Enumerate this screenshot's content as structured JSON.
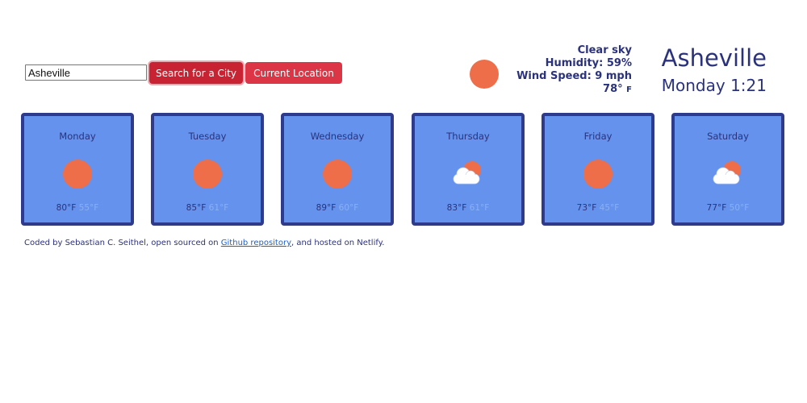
{
  "search": {
    "value": "Asheville",
    "search_button_label": "Search for a City",
    "location_button_label": "Current Location"
  },
  "current": {
    "icon": "sun-icon",
    "description": "Clear sky",
    "humidity": "Humidity: 59%",
    "wind": "Wind Speed: 9 mph",
    "temperature": "78°",
    "temperature_unit": "F",
    "city": "Asheville",
    "day_time": "Monday 1:21"
  },
  "forecast": [
    {
      "day": "Monday",
      "icon": "sun-icon",
      "high": "80°F",
      "low": "55°F"
    },
    {
      "day": "Tuesday",
      "icon": "sun-icon",
      "high": "85°F",
      "low": "61°F"
    },
    {
      "day": "Wednesday",
      "icon": "sun-icon",
      "high": "89°F",
      "low": "60°F"
    },
    {
      "day": "Thursday",
      "icon": "partly-cloudy-icon",
      "high": "83°F",
      "low": "61°F"
    },
    {
      "day": "Friday",
      "icon": "sun-icon",
      "high": "73°F",
      "low": "45°F"
    },
    {
      "day": "Saturday",
      "icon": "partly-cloudy-icon",
      "high": "77°F",
      "low": "50°F"
    }
  ],
  "footer": {
    "text_before": "Coded by Sebastian C. Seithel, open sourced on ",
    "link_text": "Github repository",
    "text_after": ", and hosted on Netlify."
  },
  "colors": {
    "card_background": "#6492ec",
    "card_border": "#2e3a8c",
    "text_primary": "#2b327c",
    "low_temp": "#8ab0f4",
    "sun": "#ee6e4a",
    "button": "#dc3545"
  }
}
